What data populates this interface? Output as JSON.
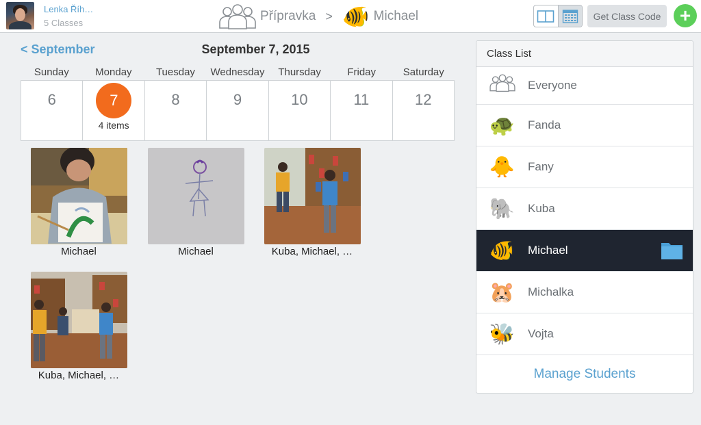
{
  "header": {
    "user_name": "Lenka Říh…",
    "user_classes": "5 Classes",
    "class_name": "Přípravka",
    "separator": ">",
    "student_emoji": "🐠",
    "student_name": "Michael",
    "get_class_code_label": "Get Class Code",
    "add_label": "+"
  },
  "calendar": {
    "back_label": "< September",
    "date_title": "September 7, 2015",
    "weekdays": [
      "Sunday",
      "Monday",
      "Tuesday",
      "Wednesday",
      "Thursday",
      "Friday",
      "Saturday"
    ],
    "days": [
      "6",
      "7",
      "8",
      "9",
      "10",
      "11",
      "12"
    ],
    "selected_items_label": "4 items"
  },
  "photos": [
    {
      "caption": "Michael"
    },
    {
      "caption": "Michael"
    },
    {
      "caption": "Kuba,  Michael,  …"
    },
    {
      "caption": "Kuba,  Michael,  …"
    }
  ],
  "class_list": {
    "title": "Class List",
    "items": [
      {
        "name": "Everyone",
        "icon": "group-icon"
      },
      {
        "name": "Fanda",
        "icon": "🐢"
      },
      {
        "name": "Fany",
        "icon": "🐥"
      },
      {
        "name": "Kuba",
        "icon": "🐘"
      },
      {
        "name": "Michael",
        "icon": "🐠"
      },
      {
        "name": "Michalka",
        "icon": "🐹"
      },
      {
        "name": "Vojta",
        "icon": "🐝"
      }
    ],
    "manage_label": "Manage Students"
  },
  "colors": {
    "accent_blue": "#5aa1cf",
    "selected_day": "#f26b1d",
    "add_green": "#5ccf5a",
    "selected_row": "#1f2530"
  }
}
